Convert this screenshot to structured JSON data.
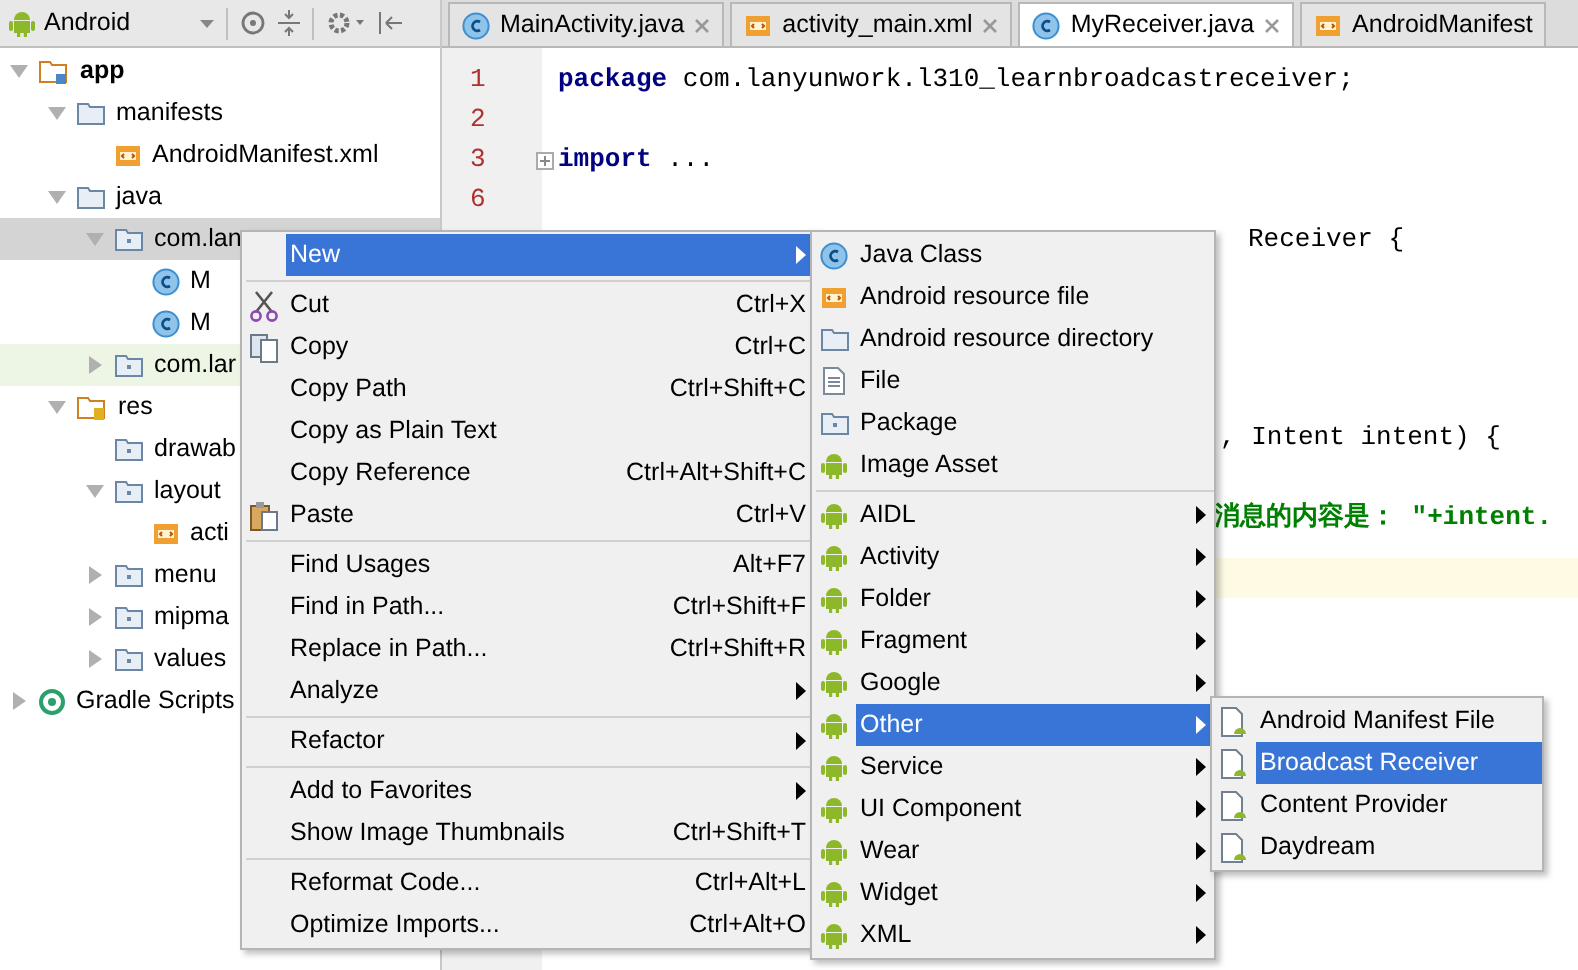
{
  "project_panel": {
    "view_selector": "Android"
  },
  "tabs": [
    {
      "label": "MainActivity.java",
      "kind": "class",
      "selected": false
    },
    {
      "label": "activity_main.xml",
      "kind": "xml",
      "selected": false
    },
    {
      "label": "MyReceiver.java",
      "kind": "class",
      "selected": true
    },
    {
      "label": "AndroidManifest",
      "kind": "xml",
      "selected": false
    }
  ],
  "tree": [
    {
      "label": "app",
      "kind": "module",
      "expanded": true,
      "selected": false,
      "children": [
        {
          "label": "manifests",
          "kind": "folder",
          "expanded": true,
          "selected": false,
          "children": [
            {
              "label": "AndroidManifest.xml",
              "kind": "xml",
              "selected": false
            }
          ]
        },
        {
          "label": "java",
          "kind": "folder",
          "expanded": true,
          "selected": false,
          "children": [
            {
              "label": "com.lan",
              "kind": "package",
              "expanded": true,
              "selected": true,
              "children": [
                {
                  "label": "M",
                  "kind": "class",
                  "selected": false
                },
                {
                  "label": "M",
                  "kind": "class",
                  "selected": false
                }
              ]
            },
            {
              "label": "com.lar",
              "kind": "package",
              "expanded": false,
              "selected": false,
              "highlighted": true
            }
          ]
        },
        {
          "label": "res",
          "kind": "res",
          "expanded": true,
          "selected": false,
          "children": [
            {
              "label": "drawab",
              "kind": "package",
              "selected": false
            },
            {
              "label": "layout",
              "kind": "package",
              "expanded": true,
              "selected": false,
              "children": [
                {
                  "label": "acti",
                  "kind": "xml",
                  "selected": false
                }
              ]
            },
            {
              "label": "menu",
              "kind": "package",
              "expanded": false,
              "selected": false
            },
            {
              "label": "mipma",
              "kind": "package",
              "expanded": false,
              "selected": false
            },
            {
              "label": "values",
              "kind": "package",
              "expanded": false,
              "selected": false
            }
          ]
        }
      ]
    },
    {
      "label": "Gradle Scripts",
      "kind": "gradle",
      "expanded": false,
      "selected": false
    }
  ],
  "editor": {
    "lines": [
      {
        "number": "1",
        "text": "**package** com.lanyunwork.l310_learnbroadcastreceiver;"
      },
      {
        "number": "2"
      },
      {
        "number": "3",
        "text": "**import** ...",
        "folded": true
      },
      {
        "number": "6"
      }
    ],
    "fragments": [
      {
        "kind": "code",
        "text": "Receiver {"
      },
      {
        "kind": "code",
        "text": ", Intent intent) {"
      },
      {
        "kind": "string",
        "text": "消息的内容是：  \"+intent."
      }
    ]
  },
  "context_menu": [
    {
      "label": "New",
      "submenu": true,
      "selected": true
    },
    {
      "label": "Cut",
      "shortcut": "Ctrl+X",
      "kind": "scissors",
      "separator_before": true,
      "selected": false
    },
    {
      "label": "Copy",
      "shortcut": "Ctrl+C",
      "kind": "copy",
      "selected": false
    },
    {
      "label": "Copy Path",
      "shortcut": "Ctrl+Shift+C",
      "selected": false
    },
    {
      "label": "Copy as Plain Text",
      "selected": false
    },
    {
      "label": "Copy Reference",
      "shortcut": "Ctrl+Alt+Shift+C",
      "selected": false
    },
    {
      "label": "Paste",
      "shortcut": "Ctrl+V",
      "kind": "paste",
      "selected": false
    },
    {
      "label": "Find Usages",
      "shortcut": "Alt+F7",
      "separator_before": true,
      "selected": false
    },
    {
      "label": "Find in Path...",
      "shortcut": "Ctrl+Shift+F",
      "selected": false
    },
    {
      "label": "Replace in Path...",
      "shortcut": "Ctrl+Shift+R",
      "selected": false
    },
    {
      "label": "Analyze",
      "submenu": true,
      "selected": false
    },
    {
      "label": "Refactor",
      "submenu": true,
      "separator_before": true,
      "selected": false
    },
    {
      "label": "Add to Favorites",
      "submenu": true,
      "separator_before": true,
      "selected": false
    },
    {
      "label": "Show Image Thumbnails",
      "shortcut": "Ctrl+Shift+T",
      "selected": false
    },
    {
      "label": "Reformat Code...",
      "shortcut": "Ctrl+Alt+L",
      "separator_before": true,
      "selected": false
    },
    {
      "label": "Optimize Imports...",
      "shortcut": "Ctrl+Alt+O",
      "selected": false
    }
  ],
  "new_submenu": [
    {
      "label": "Java Class",
      "kind": "class",
      "selected": false
    },
    {
      "label": "Android resource file",
      "kind": "xml",
      "selected": false
    },
    {
      "label": "Android resource directory",
      "kind": "folder",
      "selected": false
    },
    {
      "label": "File",
      "kind": "file",
      "selected": false
    },
    {
      "label": "Package",
      "kind": "package",
      "selected": false
    },
    {
      "label": "Image Asset",
      "kind": "android",
      "selected": false
    },
    {
      "label": "AIDL",
      "kind": "android",
      "submenu": true,
      "separator_before": true,
      "selected": false
    },
    {
      "label": "Activity",
      "kind": "android",
      "submenu": true,
      "selected": false
    },
    {
      "label": "Folder",
      "kind": "android",
      "submenu": true,
      "selected": false
    },
    {
      "label": "Fragment",
      "kind": "android",
      "submenu": true,
      "selected": false
    },
    {
      "label": "Google",
      "kind": "android",
      "submenu": true,
      "selected": false
    },
    {
      "label": "Other",
      "kind": "android",
      "submenu": true,
      "selected": true
    },
    {
      "label": "Service",
      "kind": "android",
      "submenu": true,
      "selected": false
    },
    {
      "label": "UI Component",
      "kind": "android",
      "submenu": true,
      "selected": false
    },
    {
      "label": "Wear",
      "kind": "android",
      "submenu": true,
      "selected": false
    },
    {
      "label": "Widget",
      "kind": "android",
      "submenu": true,
      "selected": false
    },
    {
      "label": "XML",
      "kind": "android",
      "submenu": true,
      "selected": false
    }
  ],
  "other_submenu": [
    {
      "label": "Android Manifest File",
      "kind": "doc",
      "selected": false
    },
    {
      "label": "Broadcast Receiver",
      "kind": "doc",
      "selected": true
    },
    {
      "label": "Content Provider",
      "kind": "doc",
      "selected": false
    },
    {
      "label": "Daydream",
      "kind": "doc",
      "selected": false
    }
  ]
}
